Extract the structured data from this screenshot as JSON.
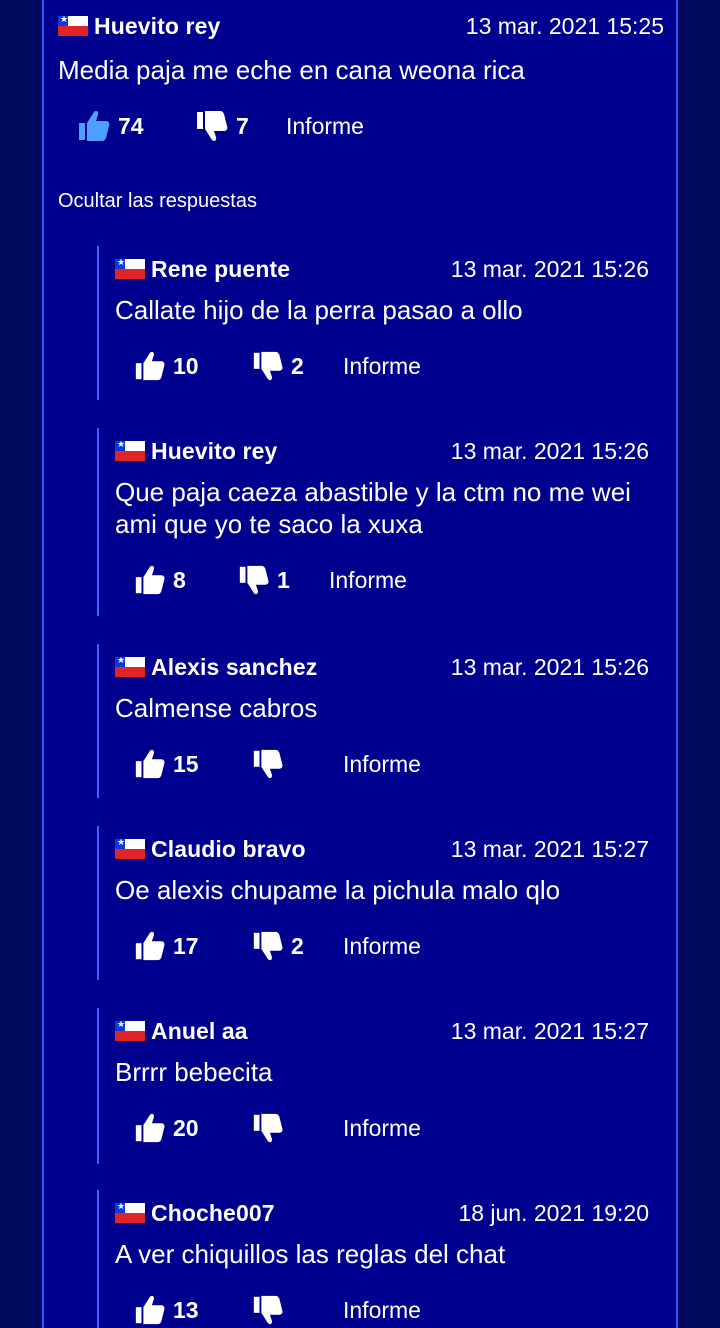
{
  "colors": {
    "background": "#000a5c",
    "panel": "#00008f",
    "border": "#2f55ff",
    "flag_red": "#e0242a",
    "flag_blue": "#0c3bd9",
    "thumb_up_main": "#4da0ff"
  },
  "main_comment": {
    "author": "Huevito rey",
    "date": "13 mar. 2021 15:25",
    "text": "Media paja me eche en cana weona rica",
    "likes": "74",
    "dislikes": "7",
    "report": "Informe",
    "flag_icon": "chile-flag-icon"
  },
  "hide_replies": "Ocultar las respuestas",
  "replies": [
    {
      "author": "Rene puente",
      "date": "13 mar. 2021 15:26",
      "text": "Callate hijo de la perra pasao a ollo",
      "likes": "10",
      "dislikes": "2",
      "report": "Informe"
    },
    {
      "author": "Huevito rey",
      "date": "13 mar. 2021 15:26",
      "text": "Que paja caeza abastible y la ctm no me wei ami que yo te saco la xuxa",
      "likes": "8",
      "dislikes": "1",
      "report": "Informe"
    },
    {
      "author": "Alexis sanchez",
      "date": "13 mar. 2021 15:26",
      "text": "Calmense cabros",
      "likes": "15",
      "dislikes": "",
      "report": "Informe"
    },
    {
      "author": "Claudio bravo",
      "date": "13 mar. 2021 15:27",
      "text": "Oe alexis chupame la pichula malo qlo",
      "likes": "17",
      "dislikes": "2",
      "report": "Informe"
    },
    {
      "author": "Anuel aa",
      "date": "13 mar. 2021 15:27",
      "text": "Brrrr bebecita",
      "likes": "20",
      "dislikes": "",
      "report": "Informe"
    },
    {
      "author": "Choche007",
      "date": "18 jun. 2021 19:20",
      "text": "A ver chiquillos las reglas del chat",
      "likes": "13",
      "dislikes": "",
      "report": "Informe"
    }
  ]
}
